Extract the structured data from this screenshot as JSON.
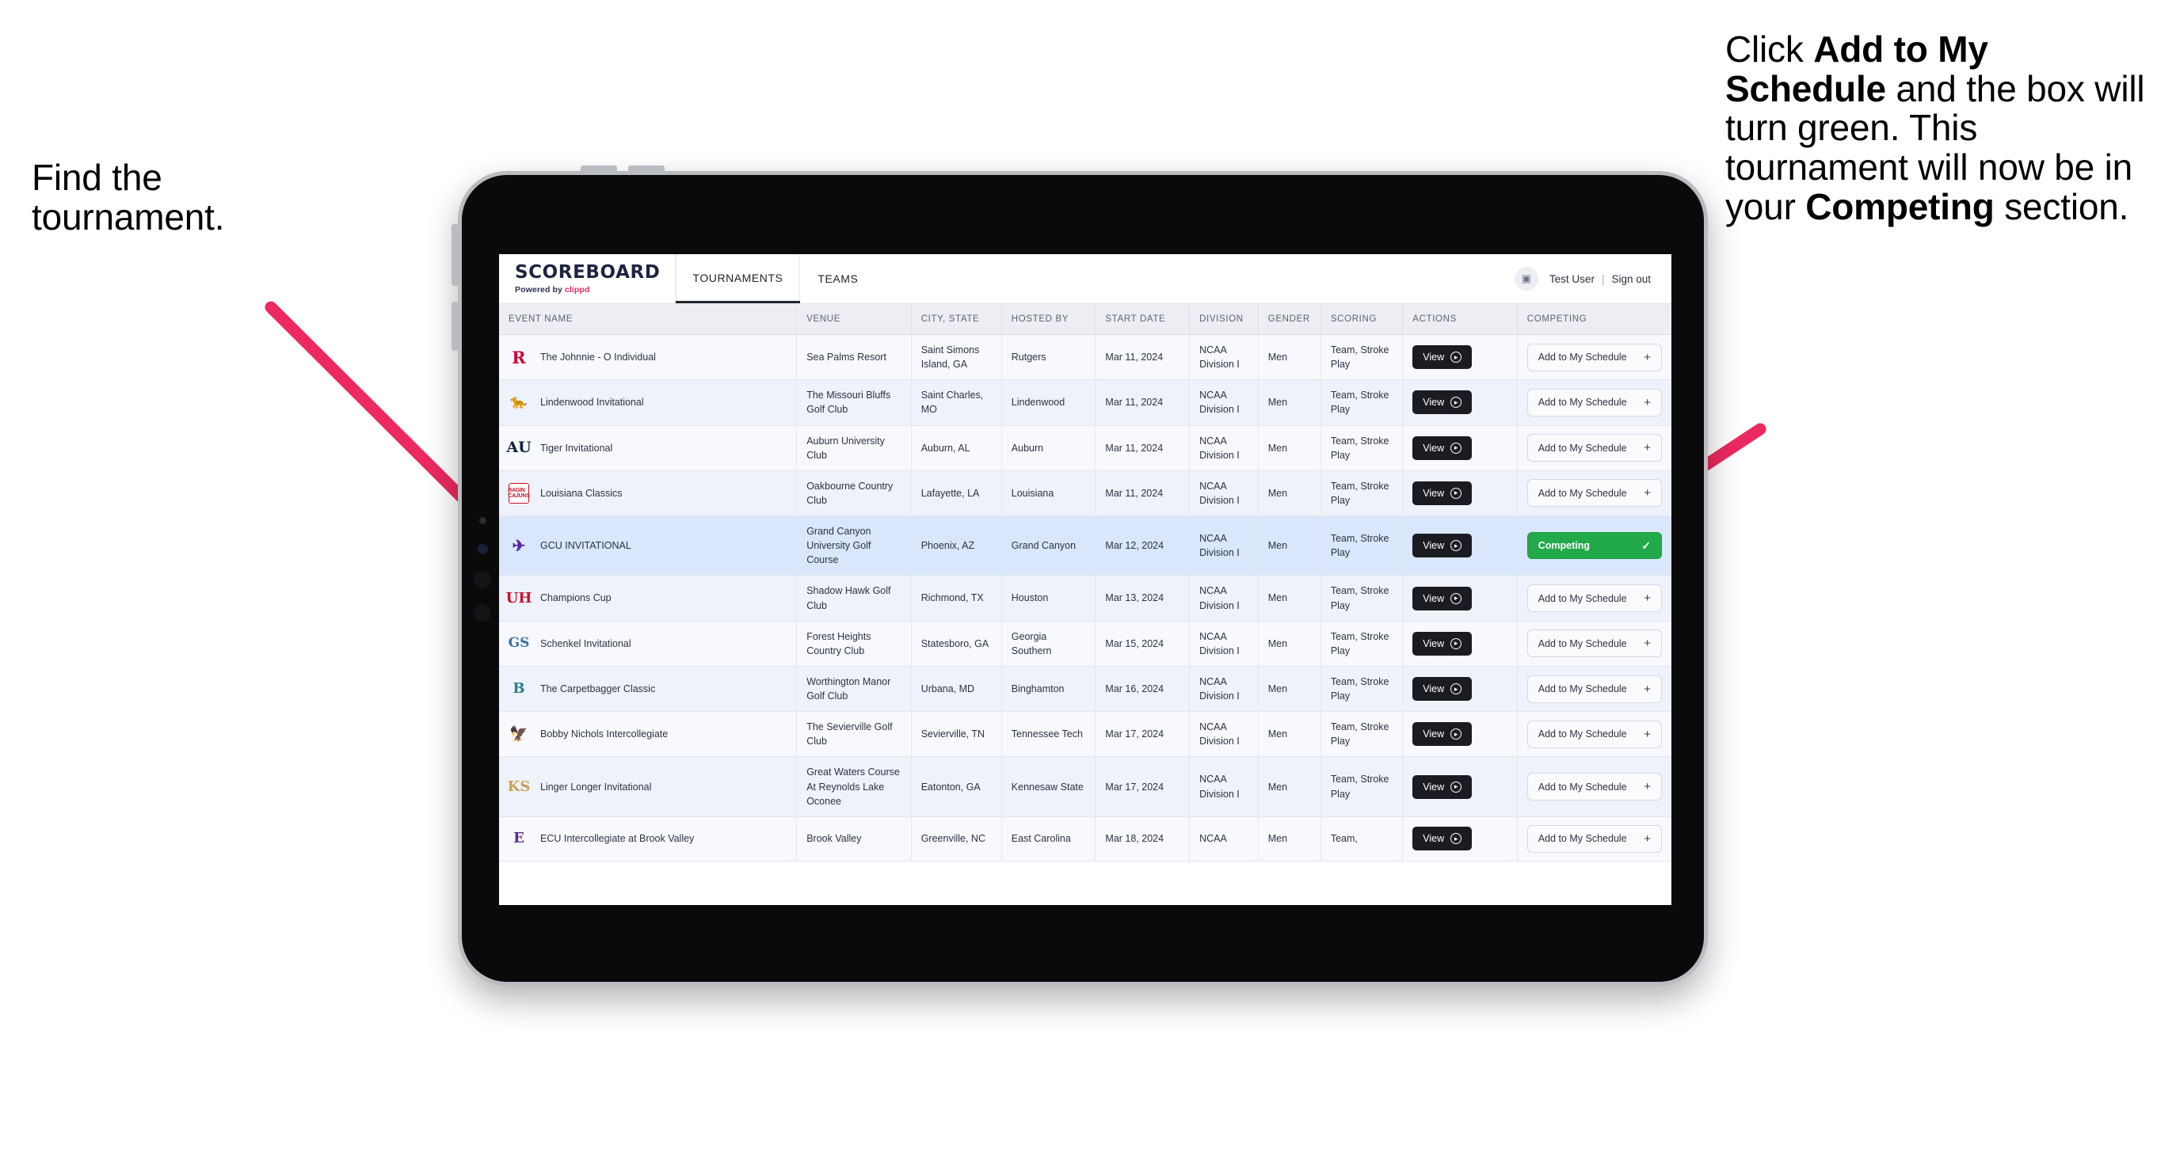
{
  "annotations": {
    "left": {
      "line1": "Find the",
      "line2": "tournament."
    },
    "right": {
      "seg1": "Click ",
      "bold1": "Add to My Schedule",
      "seg2": " and the box will turn green. This tournament will now be in your ",
      "bold2": "Competing",
      "seg3": " section."
    },
    "arrow_color": "#ec2a5f"
  },
  "app": {
    "brand": {
      "name": "SCOREBOARD",
      "powered_prefix": "Powered by ",
      "powered_brand": "clippd"
    },
    "tabs": [
      {
        "label": "TOURNAMENTS",
        "active": true
      },
      {
        "label": "TEAMS",
        "active": false
      }
    ],
    "user": {
      "avatar_icon": "user-avatar-icon",
      "name": "Test User",
      "separator": "|",
      "sign_out": "Sign out"
    },
    "colors": {
      "accent_pink": "#ec2a5f",
      "competing_green": "#22a94a",
      "dark_button": "#1b1c22",
      "selected_row": "#d9e6fb"
    }
  },
  "table": {
    "columns": [
      "EVENT NAME",
      "VENUE",
      "CITY, STATE",
      "HOSTED BY",
      "START DATE",
      "DIVISION",
      "GENDER",
      "SCORING",
      "ACTIONS",
      "COMPETING"
    ],
    "view_label": "View",
    "add_label": "Add to My Schedule",
    "add_icon": "+",
    "competing_label": "Competing",
    "competing_icon": "✓",
    "rows": [
      {
        "logo": "R",
        "logo_class": "rutgers",
        "event": "The Johnnie - O Individual",
        "venue": "Sea Palms Resort",
        "city": "Saint Simons Island, GA",
        "host": "Rutgers",
        "date": "Mar 11, 2024",
        "division": "NCAA Division I",
        "gender": "Men",
        "scoring": "Team, Stroke Play",
        "competing": false
      },
      {
        "logo": "🐆",
        "logo_class": "lindenwood",
        "event": "Lindenwood Invitational",
        "venue": "The Missouri Bluffs Golf Club",
        "city": "Saint Charles, MO",
        "host": "Lindenwood",
        "date": "Mar 11, 2024",
        "division": "NCAA Division I",
        "gender": "Men",
        "scoring": "Team, Stroke Play",
        "competing": false
      },
      {
        "logo": "AU",
        "logo_class": "auburn",
        "event": "Tiger Invitational",
        "venue": "Auburn University Club",
        "city": "Auburn, AL",
        "host": "Auburn",
        "date": "Mar 11, 2024",
        "division": "NCAA Division I",
        "gender": "Men",
        "scoring": "Team, Stroke Play",
        "competing": false
      },
      {
        "logo": "RAGIN CAJUNS",
        "logo_class": "louisiana",
        "event": "Louisiana Classics",
        "venue": "Oakbourne Country Club",
        "city": "Lafayette, LA",
        "host": "Louisiana",
        "date": "Mar 11, 2024",
        "division": "NCAA Division I",
        "gender": "Men",
        "scoring": "Team, Stroke Play",
        "competing": false
      },
      {
        "logo": "✈",
        "logo_class": "gcu",
        "event": "GCU INVITATIONAL",
        "venue": "Grand Canyon University Golf Course",
        "city": "Phoenix, AZ",
        "host": "Grand Canyon",
        "date": "Mar 12, 2024",
        "division": "NCAA Division I",
        "gender": "Men",
        "scoring": "Team, Stroke Play",
        "competing": true
      },
      {
        "logo": "UH",
        "logo_class": "houston",
        "event": "Champions Cup",
        "venue": "Shadow Hawk Golf Club",
        "city": "Richmond, TX",
        "host": "Houston",
        "date": "Mar 13, 2024",
        "division": "NCAA Division I",
        "gender": "Men",
        "scoring": "Team, Stroke Play",
        "competing": false
      },
      {
        "logo": "GS",
        "logo_class": "gasouthern",
        "event": "Schenkel Invitational",
        "venue": "Forest Heights Country Club",
        "city": "Statesboro, GA",
        "host": "Georgia Southern",
        "date": "Mar 15, 2024",
        "division": "NCAA Division I",
        "gender": "Men",
        "scoring": "Team, Stroke Play",
        "competing": false
      },
      {
        "logo": "B",
        "logo_class": "binghamton",
        "event": "The Carpetbagger Classic",
        "venue": "Worthington Manor Golf Club",
        "city": "Urbana, MD",
        "host": "Binghamton",
        "date": "Mar 16, 2024",
        "division": "NCAA Division I",
        "gender": "Men",
        "scoring": "Team, Stroke Play",
        "competing": false
      },
      {
        "logo": "🦅",
        "logo_class": "tntech",
        "event": "Bobby Nichols Intercollegiate",
        "venue": "The Sevierville Golf Club",
        "city": "Sevierville, TN",
        "host": "Tennessee Tech",
        "date": "Mar 17, 2024",
        "division": "NCAA Division I",
        "gender": "Men",
        "scoring": "Team, Stroke Play",
        "competing": false
      },
      {
        "logo": "KS",
        "logo_class": "kennesaw",
        "event": "Linger Longer Invitational",
        "venue": "Great Waters Course At Reynolds Lake Oconee",
        "city": "Eatonton, GA",
        "host": "Kennesaw State",
        "date": "Mar 17, 2024",
        "division": "NCAA Division I",
        "gender": "Men",
        "scoring": "Team, Stroke Play",
        "competing": false
      },
      {
        "logo": "E",
        "logo_class": "ecu",
        "event": "ECU Intercollegiate at Brook Valley",
        "venue": "Brook Valley",
        "city": "Greenville, NC",
        "host": "East Carolina",
        "date": "Mar 18, 2024",
        "division": "NCAA",
        "gender": "Men",
        "scoring": "Team,",
        "competing": false,
        "clipped": true
      }
    ]
  }
}
